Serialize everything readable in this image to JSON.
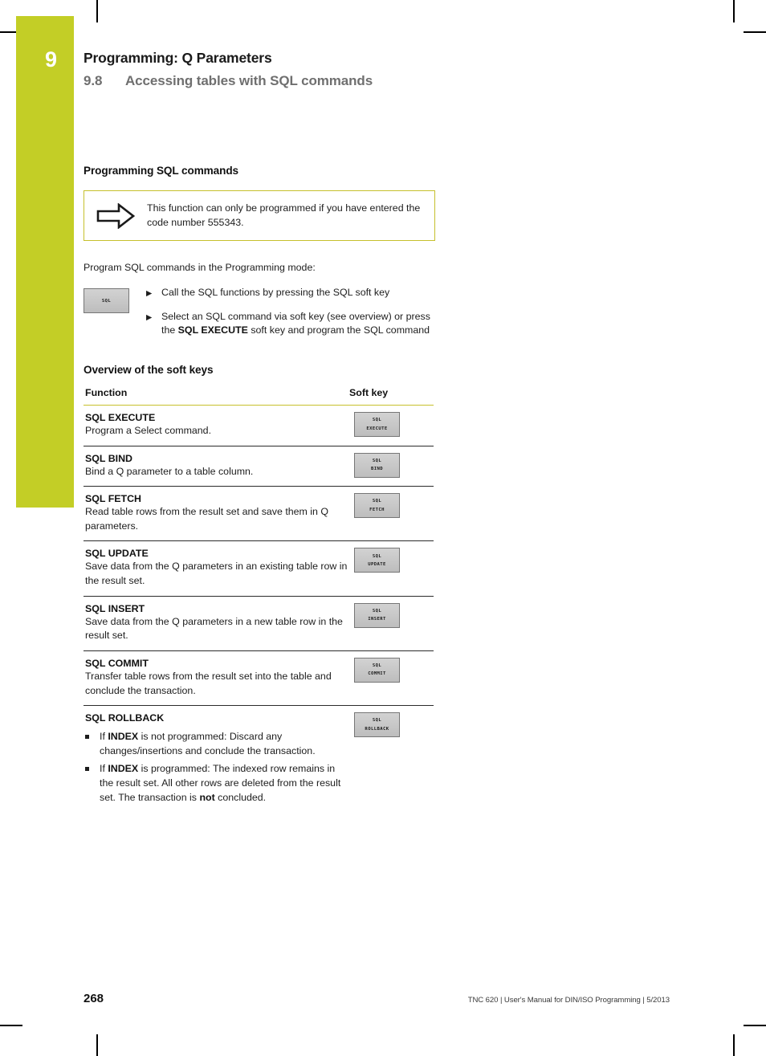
{
  "chapter": {
    "number": "9",
    "title": "Programming: Q Parameters",
    "section_number": "9.8",
    "section_title": "Accessing tables with SQL commands",
    "accent_green": "#C3CE26",
    "accent_yellow": "#C6C02C"
  },
  "programming": {
    "heading": "Programming SQL commands",
    "note": {
      "icon": "arrow-right-icon",
      "text": "This function can only be programmed if you have entered the code number 555343."
    },
    "intro": "Program SQL commands in the Programming mode:",
    "softkey": {
      "line1": "SQL",
      "line2": ""
    },
    "steps": [
      {
        "bullet": "▶",
        "text_before": "Call the SQL functions by pressing the SQL soft key",
        "bold": "",
        "text_after": ""
      },
      {
        "bullet": "▶",
        "text_before": "Select an SQL command via soft key (see overview) or press the ",
        "bold": "SQL EXECUTE",
        "text_after": " soft key and program the SQL command"
      }
    ]
  },
  "overview": {
    "heading": "Overview of the soft keys",
    "columns": {
      "function": "Function",
      "softkey": "Soft key"
    },
    "rows": [
      {
        "name": "SQL EXECUTE",
        "desc": "Program a Select command.",
        "key": {
          "line1": "SQL",
          "line2": "EXECUTE"
        },
        "bullets": []
      },
      {
        "name": "SQL BIND",
        "desc": "Bind a Q parameter to a table column.",
        "key": {
          "line1": "SQL",
          "line2": "BIND"
        },
        "bullets": []
      },
      {
        "name": "SQL FETCH",
        "desc": "Read table rows from the result set and save them in Q parameters.",
        "key": {
          "line1": "SQL",
          "line2": "FETCH"
        },
        "bullets": []
      },
      {
        "name": "SQL UPDATE",
        "desc": "Save data from the Q parameters in an existing table row in the result set.",
        "key": {
          "line1": "SQL",
          "line2": "UPDATE"
        },
        "bullets": []
      },
      {
        "name": "SQL INSERT",
        "desc": "Save data from the Q parameters in a new table row in the result set.",
        "key": {
          "line1": "SQL",
          "line2": "INSERT"
        },
        "bullets": []
      },
      {
        "name": "SQL COMMIT",
        "desc": "Transfer table rows from the result set into the table and conclude the transaction.",
        "key": {
          "line1": "SQL",
          "line2": "COMMIT"
        },
        "bullets": []
      },
      {
        "name": "SQL ROLLBACK",
        "desc": "",
        "key": {
          "line1": "SQL",
          "line2": "ROLLBACK"
        },
        "bullets": [
          {
            "pre": "If ",
            "bold": "INDEX",
            "post": " is not programmed: Discard any changes/insertions and conclude the transaction."
          },
          {
            "pre": "If ",
            "bold": "INDEX",
            "post": " is programmed: The indexed row remains in the result set. All other rows are deleted from the result set. The transaction is ",
            "bold2": "not",
            "post2": " concluded."
          }
        ]
      }
    ]
  },
  "footer": {
    "page_number": "268",
    "info": "TNC 620 | User's Manual for DIN/ISO Programming | 5/2013"
  }
}
